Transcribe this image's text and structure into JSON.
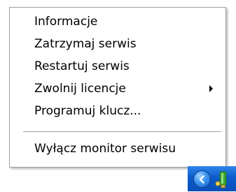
{
  "context_menu": {
    "items": [
      {
        "label": "Informacje",
        "has_submenu": false
      },
      {
        "label": "Zatrzymaj serwis",
        "has_submenu": false
      },
      {
        "label": "Restartuj serwis",
        "has_submenu": false
      },
      {
        "label": "Zwolnij licencje",
        "has_submenu": true
      },
      {
        "label": "Programuj klucz...",
        "has_submenu": false
      },
      {
        "label": "Wyłącz monitor serwisu",
        "has_submenu": false
      }
    ]
  },
  "taskbar": {
    "tray_icons": [
      "chevron-left-icon",
      "usb-key-icon"
    ]
  },
  "colors": {
    "menu_background": "#ffffff",
    "menu_border": "#a0a0a0",
    "taskbar_blue": "#0c5ac9",
    "tray_icon_green": "#3aa335"
  }
}
